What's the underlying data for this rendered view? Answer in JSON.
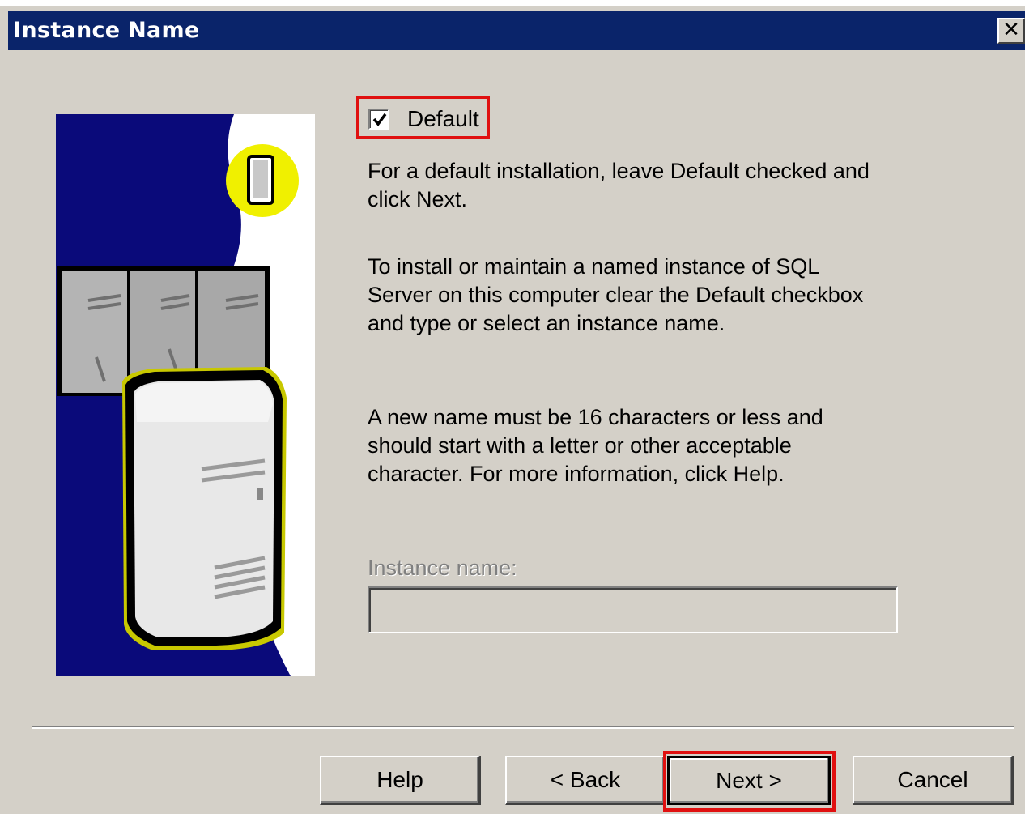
{
  "window": {
    "title": "Instance Name",
    "close_glyph": "✕"
  },
  "illustration": {
    "description_icon": "server-illustration-icon"
  },
  "default_checkbox": {
    "label": "Default",
    "checked": true
  },
  "paragraphs": {
    "p1": "For a default installation, leave Default checked and\nclick Next.",
    "p2": "To install or maintain a named instance of SQL\nServer on this computer clear the Default checkbox\nand type or select an instance name.",
    "p3": "A new name must be 16 characters or less and\nshould start with a letter or other acceptable\ncharacter.  For more information, click Help."
  },
  "instance": {
    "label": "Instance name:",
    "value": "",
    "enabled": false
  },
  "buttons": {
    "help": "Help",
    "back": "< Back",
    "next": "Next >",
    "cancel": "Cancel"
  },
  "colors": {
    "titlebar": "#0a246a",
    "dialog_bg": "#d4d0c8",
    "highlight": "#e01010",
    "illustration_blue": "#0a0a7a",
    "illustration_yellow": "#f0f000"
  }
}
